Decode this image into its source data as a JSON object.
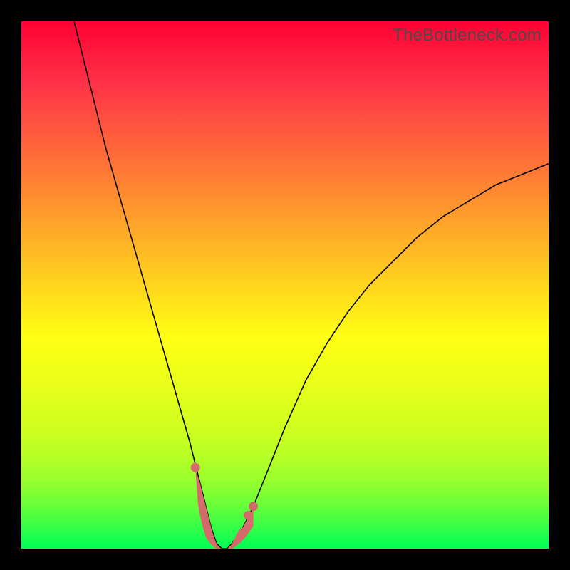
{
  "watermark": "TheBottleneck.com",
  "chart_data": {
    "type": "line",
    "title": "",
    "xlabel": "",
    "ylabel": "",
    "xlim": [
      0,
      100
    ],
    "ylim": [
      0,
      100
    ],
    "grid": false,
    "legend": false,
    "background": "vertical_gradient_red_to_green",
    "series": [
      {
        "name": "bottleneck-curve",
        "x": [
          10,
          12,
          14,
          16,
          18,
          20,
          22,
          24,
          26,
          28,
          30,
          32,
          33,
          34,
          35,
          36,
          37,
          38,
          39,
          40,
          42,
          44,
          46,
          48,
          50,
          54,
          58,
          62,
          66,
          70,
          75,
          80,
          85,
          90,
          95,
          100
        ],
        "values": [
          100,
          92,
          84,
          76,
          69,
          62,
          55,
          48,
          41,
          34,
          27,
          20,
          16,
          12,
          8,
          4,
          1,
          0,
          0,
          1,
          4,
          8,
          13,
          18,
          23,
          32,
          39,
          45,
          50,
          54,
          59,
          63,
          66,
          69,
          71,
          73
        ]
      }
    ],
    "annotations": [
      {
        "name": "minimum-band",
        "x_start": 33,
        "x_end": 43,
        "style": "thick-salmon"
      }
    ]
  }
}
